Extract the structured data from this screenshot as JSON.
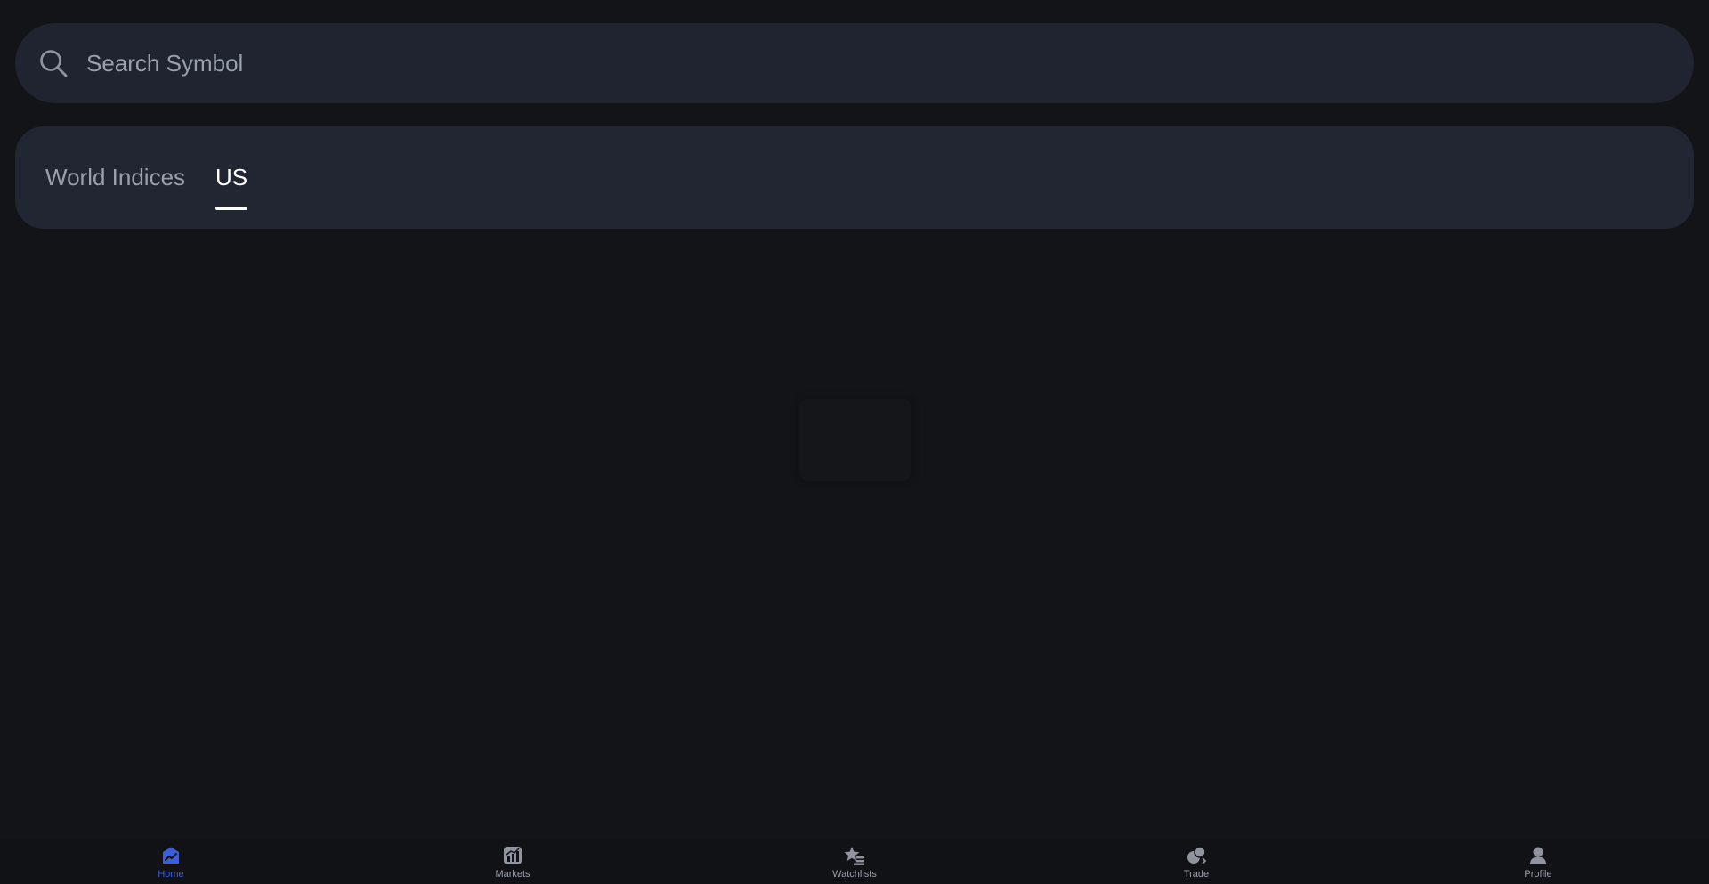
{
  "search": {
    "placeholder": "Search Symbol",
    "value": "",
    "icon": "search-icon"
  },
  "tabs": [
    {
      "label": "World Indices",
      "active": false
    },
    {
      "label": "US",
      "active": true
    }
  ],
  "bottom_nav": [
    {
      "label": "Home",
      "icon": "home-chart-icon",
      "active": true
    },
    {
      "label": "Markets",
      "icon": "markets-chart-icon",
      "active": false
    },
    {
      "label": "Watchlists",
      "icon": "star-list-icon",
      "active": false
    },
    {
      "label": "Trade",
      "icon": "trade-icon",
      "active": false
    },
    {
      "label": "Profile",
      "icon": "profile-icon",
      "active": false
    }
  ],
  "colors": {
    "background": "#131417",
    "surface": "#1f2430",
    "tab_surface": "#222532",
    "accent": "#3a5fd9",
    "muted_text": "#9aa0ab",
    "active_text": "#ffffff"
  }
}
